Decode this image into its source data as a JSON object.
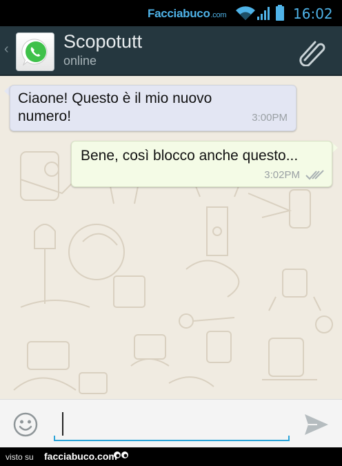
{
  "status_bar": {
    "brand": "Facciabuco",
    "brand_suffix": ".com",
    "time": "16:02",
    "accent_color": "#4fb3e8",
    "icons": [
      "wifi-icon",
      "signal-icon",
      "battery-icon"
    ]
  },
  "header": {
    "back_symbol": "‹",
    "contact_name": "Scopotutt",
    "status": "online",
    "avatar_icon": "whatsapp-logo-icon",
    "attach_icon": "paperclip-icon",
    "background_color": "#25373f"
  },
  "messages": [
    {
      "direction": "incoming",
      "text": "Ciaone! Questo è il mio nuovo numero!",
      "time": "3:00PM",
      "bubble_color": "#e3e6f3"
    },
    {
      "direction": "outgoing",
      "text": "Bene, così blocco anche questo...",
      "time": "3:02PM",
      "status_icon": "double-check-icon",
      "bubble_color": "#f4fbe6"
    }
  ],
  "composer": {
    "emoji_icon": "smiley-icon",
    "value": "",
    "send_icon": "send-icon",
    "underline_color": "#2aa3d8"
  },
  "footer": {
    "visto_label": "visto su",
    "site": "facciabuco.com",
    "icon": "eyes-icon"
  }
}
